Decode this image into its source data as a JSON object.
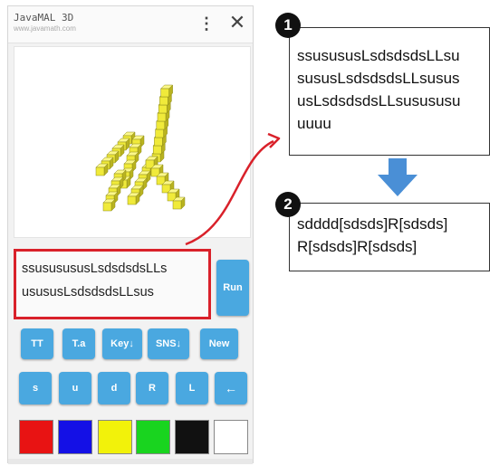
{
  "phone": {
    "app_title": "JavaMAL 3D",
    "app_url": "www.javamath.com",
    "menu_icon": "kebab-menu-icon",
    "close_icon": "close-icon",
    "input_lines": [
      "ssususususLsdsdsdsLLs",
      "usususLsdsdsdsLLsus"
    ],
    "run_label": "Run",
    "row1_buttons": [
      "TT",
      "T.a",
      "Key↓",
      "SNS↓",
      "New"
    ],
    "row2_buttons": [
      "s",
      "u",
      "d",
      "R",
      "L",
      "←"
    ],
    "palette": [
      "#e81313",
      "#1410e6",
      "#f2f20a",
      "#19d41f",
      "#111111",
      "#ffffff"
    ],
    "accent_color": "#4aa8e0",
    "highlight_color": "#d9212a",
    "model_color": "#f0ea3a"
  },
  "step1": {
    "badge": "1",
    "lines": [
      "ssusususLsdsdsdsLLsu",
      "sususLsdsdsdsLLsusus",
      "usLsdsdsdsLLsusususu",
      "uuuu"
    ]
  },
  "step2": {
    "badge": "2",
    "lines": [
      "sdddd[sdsds]R[sdsds]",
      "R[sdsds]R[sdsds]"
    ]
  },
  "arrow_color": "#4a8fd6"
}
